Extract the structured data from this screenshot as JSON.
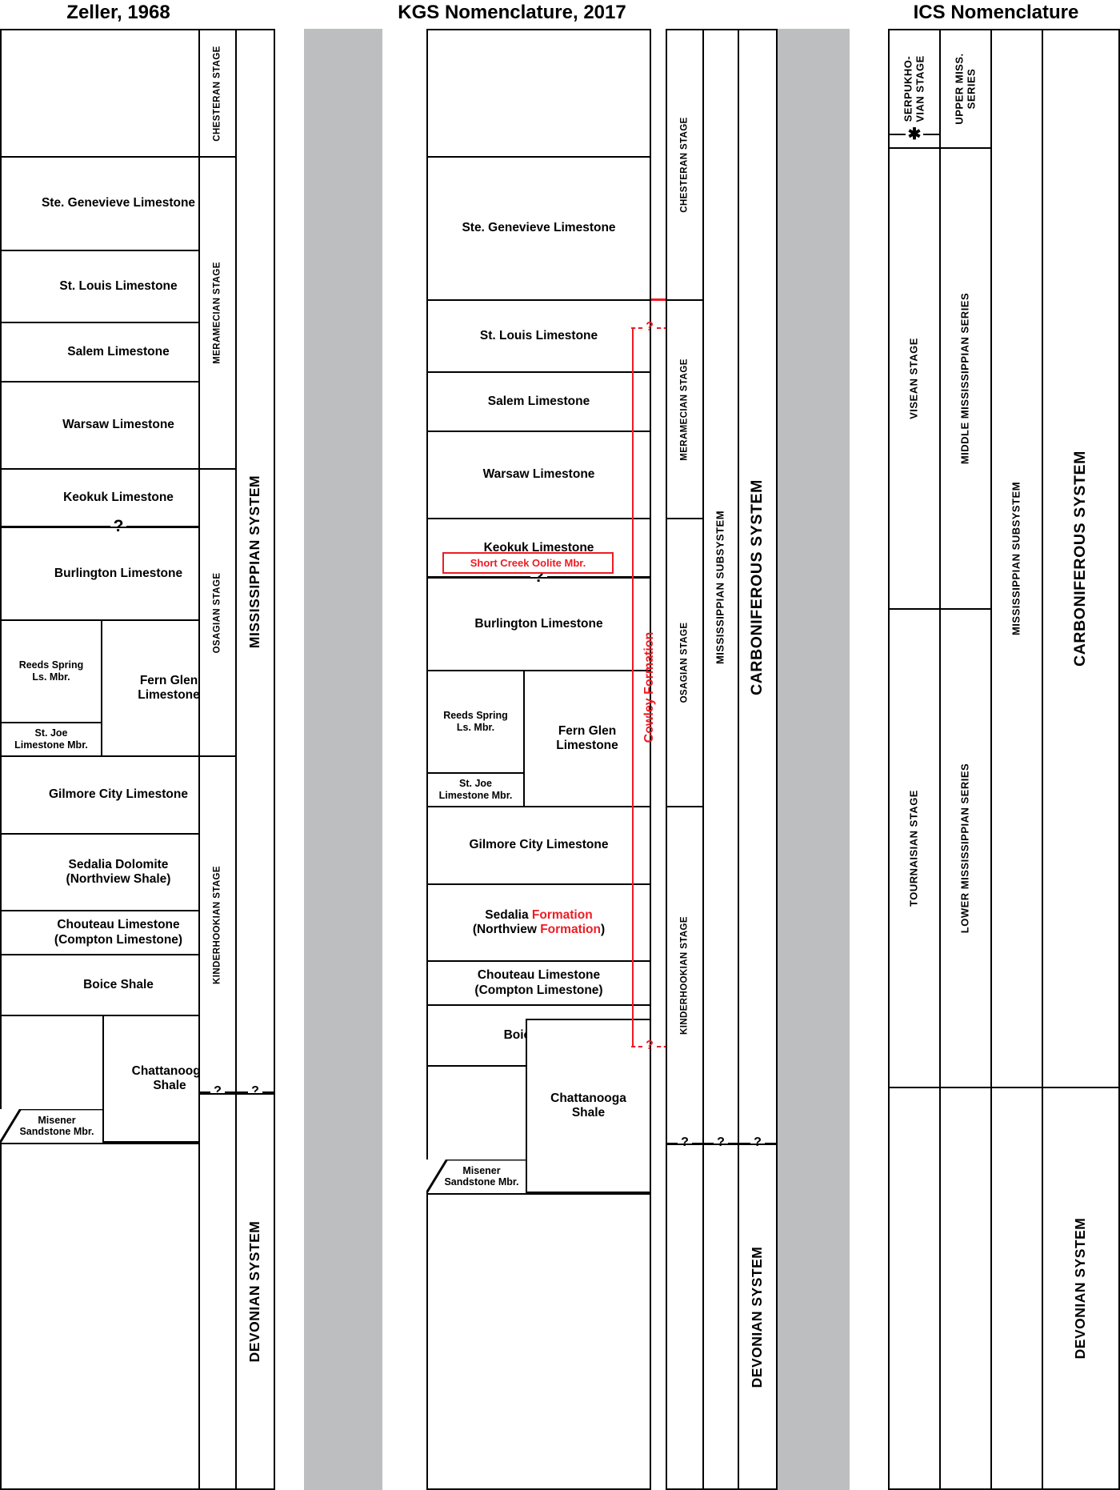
{
  "titles": {
    "zeller": "Zeller, 1968",
    "kgs": "KGS Nomenclature, 2017",
    "ics": "ICS Nomenclature"
  },
  "colors": {
    "red": "#ed1c24",
    "gray": "#bcbec0",
    "black": "#000000",
    "white": "#ffffff"
  },
  "symbols": {
    "question": "?",
    "asterisk": "✱"
  },
  "zeller": {
    "units": [
      {
        "label": "",
        "blank": true
      },
      {
        "label": "Ste. Genevieve Limestone"
      },
      {
        "label": "St. Louis Limestone"
      },
      {
        "label": "Salem Limestone"
      },
      {
        "label": "Warsaw Limestone"
      },
      {
        "label": "Keokuk Limestone"
      },
      {
        "label": "Burlington Limestone"
      },
      {
        "label": "Reeds Spring\nLs. Mbr."
      },
      {
        "label": "Fern Glen\nLimestone"
      },
      {
        "label": "St. Joe\nLimestone Mbr."
      },
      {
        "label": "Gilmore City Limestone"
      },
      {
        "label": "Sedalia Dolomite\n(Northview Shale)"
      },
      {
        "label": "Chouteau Limestone\n(Compton Limestone)"
      },
      {
        "label": "Boice Shale"
      },
      {
        "label": "Chattanooga\nShale"
      },
      {
        "label": "Misener\nSandstone Mbr."
      },
      {
        "label": "",
        "blank": true
      }
    ],
    "stages": [
      {
        "label": "CHESTERAN STAGE"
      },
      {
        "label": "MERAMECIAN STAGE"
      },
      {
        "label": "OSAGIAN STAGE"
      },
      {
        "label": "KINDERHOOKIAN STAGE"
      }
    ],
    "systems": [
      {
        "label": "MISSISSIPPIAN SYSTEM"
      },
      {
        "label": "DEVONIAN SYSTEM"
      }
    ]
  },
  "kgs": {
    "units": [
      {
        "label": "",
        "blank": true
      },
      {
        "label": "Ste. Genevieve Limestone"
      },
      {
        "label": "St. Louis Limestone"
      },
      {
        "label": "Salem Limestone"
      },
      {
        "label": "Warsaw Limestone"
      },
      {
        "label": "Keokuk Limestone"
      },
      {
        "label": "Burlington Limestone"
      },
      {
        "label": "Reeds Spring\nLs. Mbr."
      },
      {
        "label": "Fern Glen\nLimestone"
      },
      {
        "label": "St. Joe\nLimestone Mbr."
      },
      {
        "label": "Gilmore City Limestone"
      },
      {
        "label_part1": "Sedalia ",
        "label_red1": "Formation",
        "label_part2": "(Northview ",
        "label_red2": "Formation",
        "label_part3": ")"
      },
      {
        "label": "Chouteau Limestone\n(Compton Limestone)"
      },
      {
        "label": "Boice Shale"
      },
      {
        "label": "Chattanooga\nShale"
      },
      {
        "label": "Misener\nSandstone Mbr."
      },
      {
        "label": "",
        "blank": true
      }
    ],
    "oolite_member": "Short Creek Oolite Mbr.",
    "cowley_formation": "Cowley Formation",
    "stages": [
      {
        "label": "CHESTERAN STAGE"
      },
      {
        "label": "MERAMECIAN STAGE"
      },
      {
        "label": "OSAGIAN STAGE"
      },
      {
        "label": "KINDERHOOKIAN STAGE"
      }
    ],
    "subsystem": "MISSISSIPPIAN SUBSYSTEM",
    "systems": [
      {
        "label": "CARBONIFEROUS SYSTEM"
      },
      {
        "label": "DEVONIAN SYSTEM"
      }
    ]
  },
  "ics": {
    "stages": [
      {
        "label": "SERPUKHO-\nVIAN STAGE"
      },
      {
        "label": "VISEAN STAGE"
      },
      {
        "label": "TOURNAISIAN STAGE"
      }
    ],
    "series": [
      {
        "label": "UPPER MISS.\nSERIES"
      },
      {
        "label": "MIDDLE MISSISSIPPIAN SERIES"
      },
      {
        "label": "LOWER MISSISSIPPIAN SERIES"
      }
    ],
    "subsystem": "MISSISSIPPIAN SUBSYSTEM",
    "systems": [
      {
        "label": "CARBONIFEROUS SYSTEM"
      },
      {
        "label": "DEVONIAN SYSTEM"
      }
    ]
  }
}
